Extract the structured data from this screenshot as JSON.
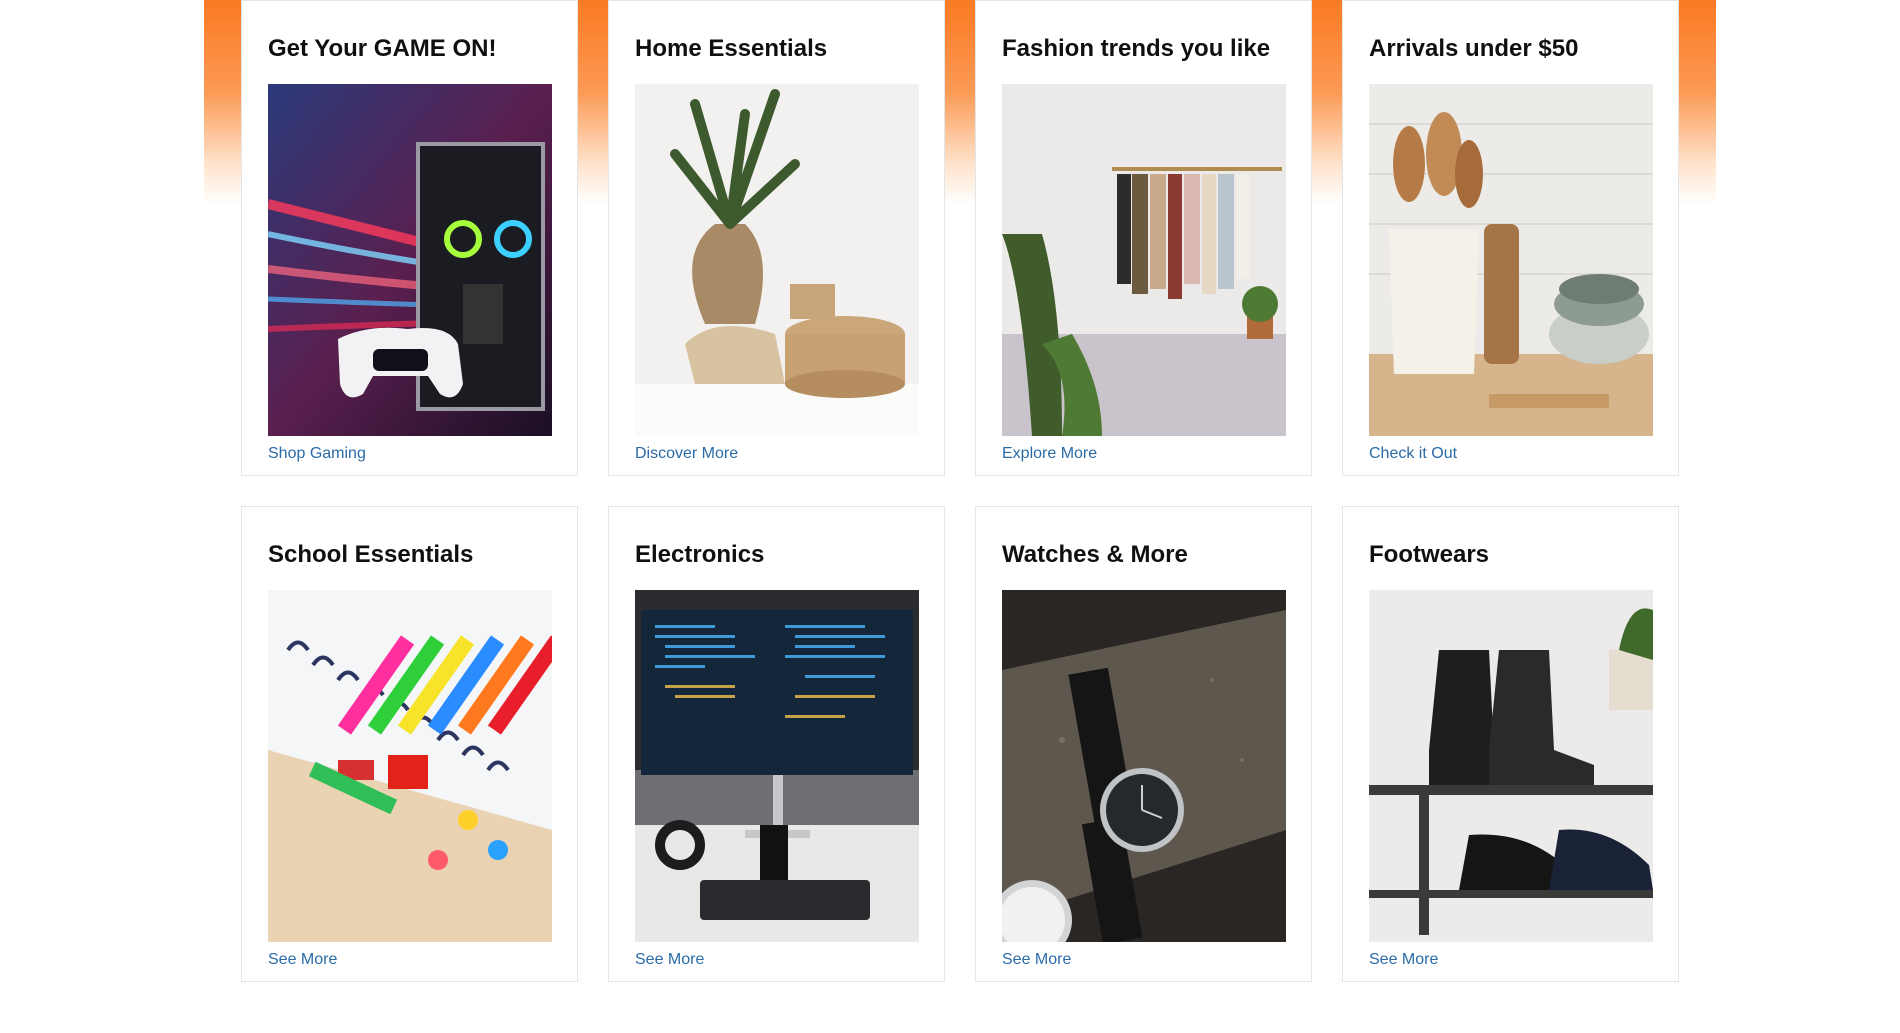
{
  "cards": [
    {
      "title": "Get Your GAME ON!",
      "link": "Shop Gaming",
      "image": "gaming-pc-and-controller-image"
    },
    {
      "title": "Home Essentials",
      "link": "Discover More",
      "image": "home-decor-plant-baskets-image"
    },
    {
      "title": "Fashion trends you like",
      "link": "Explore More",
      "image": "clothing-rack-image"
    },
    {
      "title": "Arrivals under $50",
      "link": "Check it Out",
      "image": "kitchenware-jug-bowls-image"
    },
    {
      "title": "School Essentials",
      "link": "See More",
      "image": "stationery-markers-notebook-image"
    },
    {
      "title": "Electronics",
      "link": "See More",
      "image": "monitor-keyboard-desk-image"
    },
    {
      "title": "Watches & More",
      "link": "See More",
      "image": "wristwatches-image"
    },
    {
      "title": "Footwears",
      "link": "See More",
      "image": "boots-shoe-rack-image"
    }
  ],
  "colors": {
    "accent_orange": "#fb7a23",
    "link_blue": "#2a6ba8",
    "title_text": "#0f1111",
    "card_border": "#e3e6e6"
  }
}
